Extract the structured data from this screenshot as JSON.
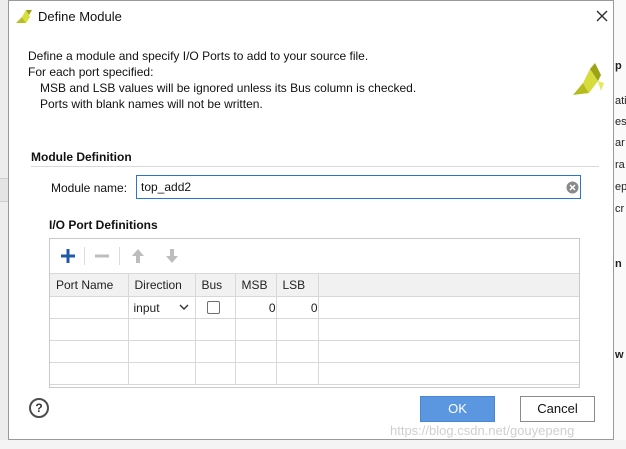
{
  "window": {
    "title": "Define Module",
    "close_icon": "close-icon"
  },
  "description": {
    "line1": "Define a module and specify I/O Ports to add to your source file.",
    "line2": "For each port specified:",
    "line3": "MSB and LSB values will be ignored unless its Bus column is checked.",
    "line4": "Ports with blank names will not be written."
  },
  "module_definition": {
    "section_title": "Module Definition",
    "name_label": "Module name:",
    "name_value": "top_add2"
  },
  "io_ports": {
    "section_title": "I/O Port Definitions",
    "toolbar_icons": [
      "plus-icon",
      "minus-icon",
      "arrow-up-icon",
      "arrow-down-icon"
    ],
    "columns": [
      "Port Name",
      "Direction",
      "Bus",
      "MSB",
      "LSB"
    ],
    "rows": [
      {
        "port_name": "",
        "direction": "input",
        "bus": false,
        "msb": "0",
        "lsb": "0"
      }
    ]
  },
  "buttons": {
    "help": "?",
    "ok": "OK",
    "cancel": "Cancel"
  },
  "watermark": "https://blog.csdn.net/gouyepeng",
  "background_right_glyphs": [
    "p",
    "ati",
    "es",
    "ar",
    "ra",
    "ep",
    "cr",
    "n",
    "w"
  ],
  "colors": {
    "accent": "#5b97e0",
    "input_border": "#2a77c9",
    "logo_yellow": "#c8cf2a"
  }
}
